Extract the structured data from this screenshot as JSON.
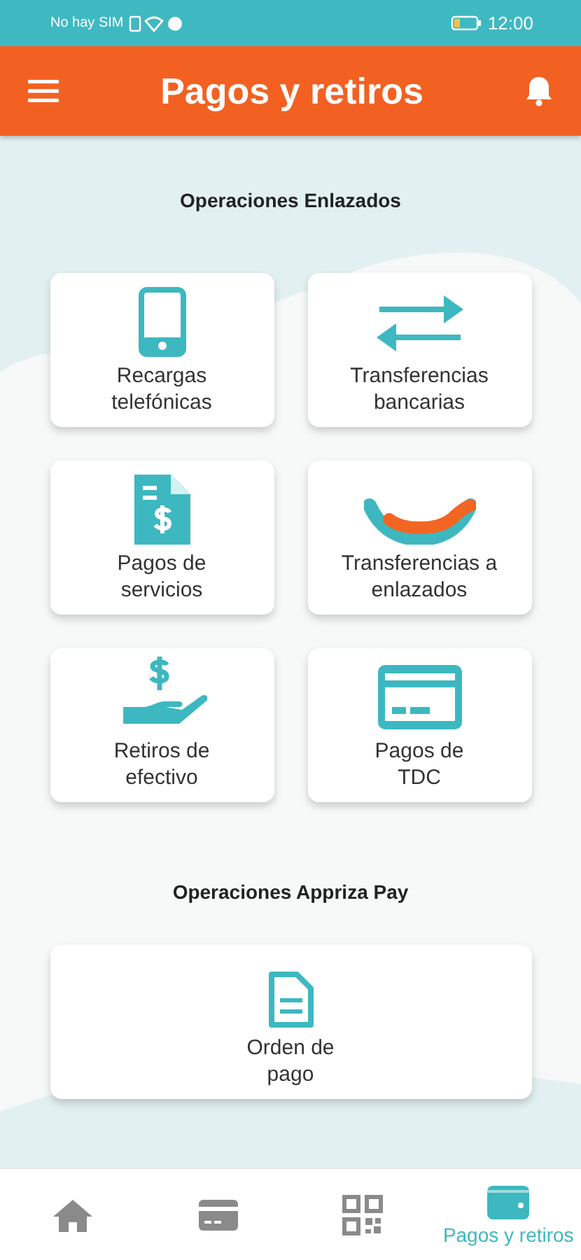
{
  "status_bar": {
    "carrier": "No hay SIM",
    "time": "12:00"
  },
  "header": {
    "title": "Pagos y retiros"
  },
  "sections": [
    {
      "title": "Operaciones Enlazados",
      "tiles": [
        {
          "kind": "phone",
          "label": "Recargas\ntelefónicas"
        },
        {
          "kind": "transfer",
          "label": "Transferencias\nbancarias"
        },
        {
          "kind": "bill",
          "label": "Pagos de\nservicios"
        },
        {
          "kind": "link",
          "label": "Transferencias a\nenlazados"
        },
        {
          "kind": "cash",
          "label": "Retiros de\nefectivo"
        },
        {
          "kind": "card",
          "label": "Pagos de\nTDC"
        }
      ]
    },
    {
      "title": "Operaciones Appriza Pay",
      "tiles": [
        {
          "kind": "doc",
          "label": "Orden de\npago"
        }
      ]
    }
  ],
  "nav": [
    {
      "kind": "home",
      "selected": false
    },
    {
      "kind": "card",
      "selected": false
    },
    {
      "kind": "qr",
      "selected": false
    },
    {
      "kind": "wallet",
      "selected": true,
      "label": "Pagos y retiros"
    }
  ]
}
